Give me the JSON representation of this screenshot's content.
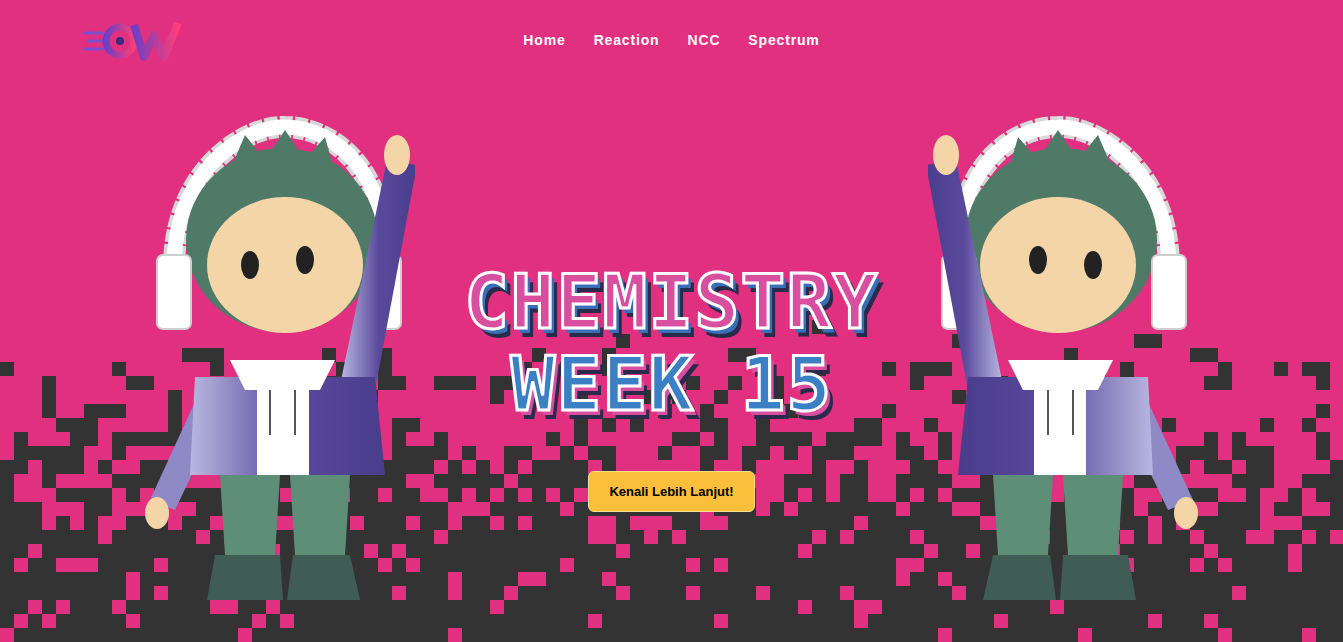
{
  "header": {
    "nav": [
      {
        "label": "Home"
      },
      {
        "label": "Reaction"
      },
      {
        "label": "NCC"
      },
      {
        "label": "Spectrum"
      }
    ]
  },
  "hero": {
    "title_lines": [
      "CHEMISTRY",
      "WEEK 15"
    ],
    "button": "Kenali Lebih Lanjut!"
  }
}
